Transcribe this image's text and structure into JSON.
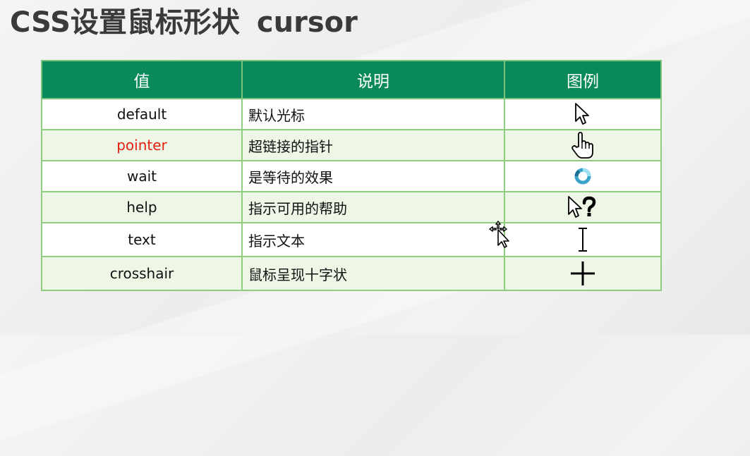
{
  "title": {
    "prefix": "CSS设置鼠标形状",
    "suffix": "cursor"
  },
  "table": {
    "headers": [
      "值",
      "说明",
      "图例"
    ],
    "header_color": "#0a8a5a",
    "border_color": "#8fce7e",
    "rows": [
      {
        "value": "default",
        "value_color": "#111111",
        "desc": "默认光标",
        "icon": "arrow-cursor-icon"
      },
      {
        "value": "pointer",
        "value_color": "#e02010",
        "desc": "超链接的指针",
        "icon": "hand-pointer-icon"
      },
      {
        "value": "wait",
        "value_color": "#111111",
        "desc": "是等待的效果",
        "icon": "busy-ring-icon"
      },
      {
        "value": "help",
        "value_color": "#111111",
        "desc": "指示可用的帮助",
        "icon": "help-cursor-icon"
      },
      {
        "value": "text",
        "value_color": "#111111",
        "desc": "指示文本",
        "icon": "text-ibeam-icon"
      },
      {
        "value": "crosshair",
        "value_color": "#111111",
        "desc": "鼠标呈现十字状",
        "icon": "crosshair-icon"
      }
    ]
  }
}
